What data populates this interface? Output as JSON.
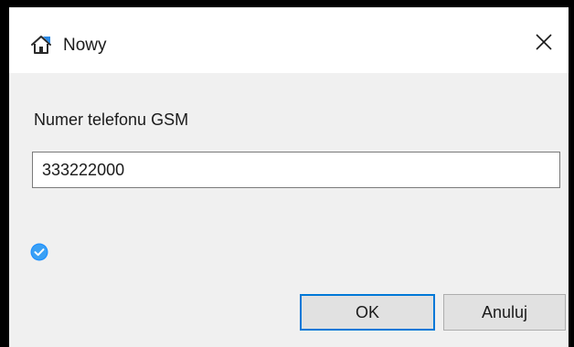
{
  "window": {
    "title": "Nowy",
    "icon": "home-icon",
    "close_icon": "close-icon"
  },
  "form": {
    "label": "Numer telefonu GSM",
    "value": "333222000",
    "status_icon": "check-circle-icon"
  },
  "buttons": {
    "ok_label": "OK",
    "cancel_label": "Anuluj"
  },
  "colors": {
    "accent": "#0078d7",
    "check": "#1e90ff"
  }
}
